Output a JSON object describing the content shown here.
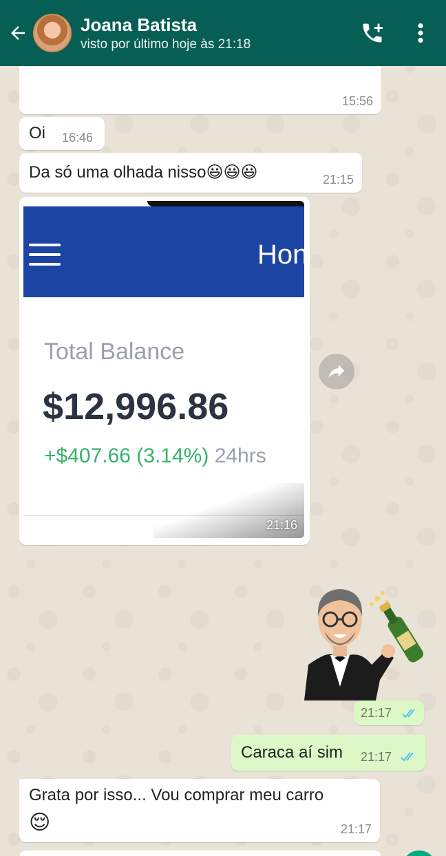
{
  "header": {
    "contact_name": "Joana Batista",
    "last_seen": "visto por último hoje às 21:18",
    "icons": [
      "back-arrow-icon",
      "avatar",
      "add-call-icon",
      "more-vert-icon"
    ]
  },
  "messages": [
    {
      "direction": "in",
      "text": "",
      "time": "15:56"
    },
    {
      "direction": "in",
      "text": "Oi",
      "time": "16:46"
    },
    {
      "direction": "in",
      "text": "Da só uma olhada nisso😃😃😃",
      "time": "21:15"
    },
    {
      "direction": "in",
      "type": "image",
      "time": "21:16",
      "image": {
        "app_title": "Hon",
        "balance_label": "Total Balance",
        "balance_value": "$12,996.86",
        "change": "+$407.66 (3.14%)",
        "period": "24hrs"
      }
    },
    {
      "direction": "out",
      "type": "sticker",
      "time": "21:17",
      "status": "read"
    },
    {
      "direction": "out",
      "text": "Caraca aí sim",
      "time": "21:17",
      "status": "read"
    },
    {
      "direction": "in",
      "text": "Grata por isso... Vou comprar meu carro",
      "emoji": "😌",
      "time": "21:17"
    }
  ],
  "colors": {
    "header": "#075e54",
    "outgoing_bubble": "#dcf8c6",
    "incoming_bubble": "#ffffff",
    "read_ticks": "#4fc3f7"
  }
}
